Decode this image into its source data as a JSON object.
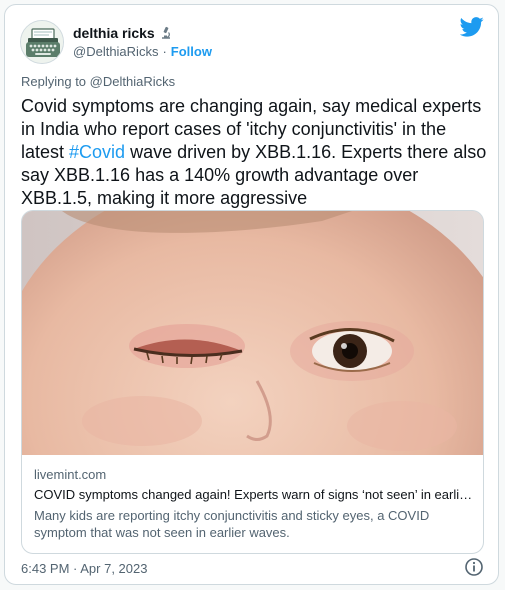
{
  "author": {
    "display_name": "delthia ricks",
    "badge_icon": "microscope-icon",
    "handle": "@DelthiaRicks",
    "separator": "·",
    "follow_label": "Follow"
  },
  "brand_icon": "twitter-bird-icon",
  "reply_context": {
    "prefix": "Replying to",
    "handle": "@DelthiaRicks"
  },
  "tweet": {
    "text_part1": "Covid symptoms are changing again, say medical experts in India who report cases of 'itchy conjunctivitis' in the latest ",
    "hashtag": "#Covid",
    "text_part2": " wave driven by XBB.1.16. Experts there also say XBB.1.16 has a 140% growth advantage over XBB.1.5, making it more aggressive"
  },
  "link_card": {
    "domain": "livemint.com",
    "title": "COVID symptoms changed again! Experts warn of signs ‘not seen’ in earli…",
    "description": "Many kids are reporting itchy conjunctivitis and sticky eyes, a COVID symptom that was not seen in earlier waves."
  },
  "timestamp": "6:43 PM · Apr 7, 2023",
  "info_icon": "info-circle-icon",
  "colors": {
    "accent": "#1d9bf0",
    "text": "#0f1419",
    "muted": "#536471",
    "border": "#cfd9de",
    "page": "#f7f9f9"
  }
}
